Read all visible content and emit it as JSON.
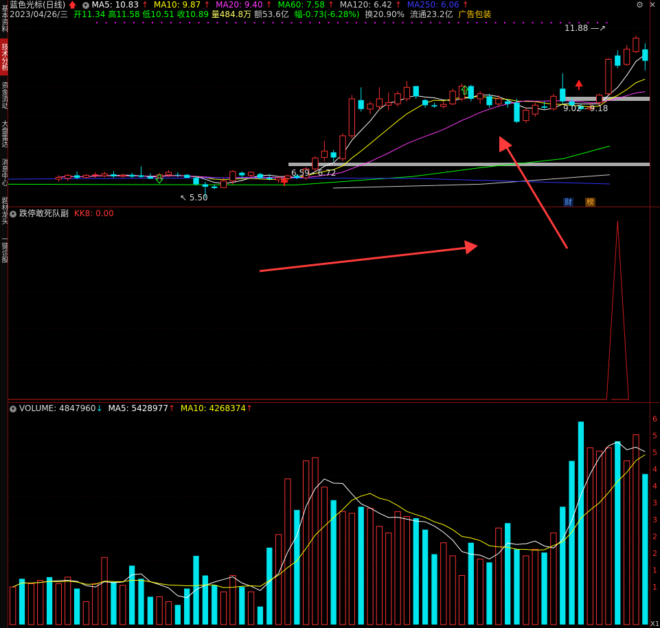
{
  "sidebar": {
    "tabs": [
      {
        "label": "基本资料",
        "active": false
      },
      {
        "label": "技术分析",
        "active": true
      },
      {
        "label": "资金流动",
        "active": false
      },
      {
        "label": "大盘雷达",
        "active": false
      },
      {
        "label": "消息中心",
        "active": false
      },
      {
        "label": "题材龙头",
        "active": false
      },
      {
        "label": "一键诊股",
        "active": false
      }
    ]
  },
  "header": {
    "title": "蓝色光标(日线)",
    "ma5": "MA5: 10.83",
    "ma10": "MA10: 9.87",
    "ma20": "MA20: 9.40",
    "ma60": "MA60: 7.58",
    "ma120": "MA120: 6.42",
    "ma250": "MA250: 6.06",
    "date": "2023/04/26/三",
    "open": "开11.34",
    "high": "高11.58",
    "low": "低10.51",
    "close": "收10.89",
    "vol": "量484.8万",
    "amount": "额53.6亿",
    "change": "幅-0.73(-6.28%)",
    "turnover": "换20.90%",
    "float": "流通23.2亿",
    "ad": "广告包装"
  },
  "price_labels": {
    "high_mark": "11.88",
    "range_upper": "9.02 - 9.18",
    "range_lower": "6.59 - 6.72",
    "low_mark": "5.50",
    "badge_cai": "财",
    "badge_bang": "榜"
  },
  "indicator": {
    "name": "跌停敢死队副",
    "value": "KK8: 0.00"
  },
  "volume_panel": {
    "volume": "VOLUME: 4847960",
    "ma5": "MA5: 5428977",
    "ma10": "MA10: 4268374"
  },
  "volume_axis": [
    "6",
    "5",
    "5",
    "4",
    "4",
    "3",
    "3",
    "2",
    "2",
    "1",
    "1"
  ],
  "volume_axis_unit": "X1",
  "colors": {
    "up": "#ff3232",
    "down": "#00e5ee",
    "ma5": "#ffffff",
    "ma10": "#ffff00",
    "ma20": "#ff3cff",
    "ma60": "#00ff00",
    "ma120": "#cccccc",
    "ma250": "#3333ff",
    "arrow": "#ff3b3b"
  },
  "chart_data": {
    "type": "candlestick",
    "candles": [
      {
        "o": 6.25,
        "h": 6.4,
        "l": 6.15,
        "c": 6.32
      },
      {
        "o": 6.28,
        "h": 6.45,
        "l": 6.18,
        "c": 6.4
      },
      {
        "o": 6.4,
        "h": 6.55,
        "l": 6.25,
        "c": 6.3
      },
      {
        "o": 6.32,
        "h": 6.45,
        "l": 6.28,
        "c": 6.4
      },
      {
        "o": 6.42,
        "h": 6.52,
        "l": 6.3,
        "c": 6.42
      },
      {
        "o": 6.38,
        "h": 6.55,
        "l": 6.32,
        "c": 6.46
      },
      {
        "o": 6.44,
        "h": 6.56,
        "l": 6.3,
        "c": 6.36
      },
      {
        "o": 6.36,
        "h": 6.46,
        "l": 6.3,
        "c": 6.4
      },
      {
        "o": 6.42,
        "h": 6.5,
        "l": 6.3,
        "c": 6.35
      },
      {
        "o": 6.4,
        "h": 6.75,
        "l": 6.3,
        "c": 6.34
      },
      {
        "o": 6.35,
        "h": 6.48,
        "l": 6.25,
        "c": 6.27
      },
      {
        "o": 6.3,
        "h": 6.5,
        "l": 6.28,
        "c": 6.42
      },
      {
        "o": 6.42,
        "h": 6.6,
        "l": 6.34,
        "c": 6.52
      },
      {
        "o": 6.42,
        "h": 6.52,
        "l": 6.33,
        "c": 6.4
      },
      {
        "o": 6.42,
        "h": 6.45,
        "l": 6.3,
        "c": 6.3
      },
      {
        "o": 6.3,
        "h": 6.38,
        "l": 6.0,
        "c": 6.05
      },
      {
        "o": 6.05,
        "h": 6.15,
        "l": 5.5,
        "c": 5.95
      },
      {
        "o": 5.96,
        "h": 6.05,
        "l": 5.85,
        "c": 5.9
      },
      {
        "o": 5.92,
        "h": 6.3,
        "l": 5.9,
        "c": 6.18
      },
      {
        "o": 6.18,
        "h": 6.6,
        "l": 6.05,
        "c": 6.55
      },
      {
        "o": 6.5,
        "h": 6.55,
        "l": 6.3,
        "c": 6.4
      },
      {
        "o": 6.4,
        "h": 6.55,
        "l": 6.3,
        "c": 6.52
      },
      {
        "o": 6.45,
        "h": 6.5,
        "l": 6.25,
        "c": 6.3
      },
      {
        "o": 6.3,
        "h": 6.45,
        "l": 6.2,
        "c": 6.25
      },
      {
        "o": 6.22,
        "h": 6.34,
        "l": 6.1,
        "c": 6.3
      },
      {
        "o": 6.28,
        "h": 6.42,
        "l": 6.18,
        "c": 6.38
      },
      {
        "o": 6.38,
        "h": 6.45,
        "l": 6.25,
        "c": 6.3
      },
      {
        "o": 6.3,
        "h": 6.72,
        "l": 6.22,
        "c": 6.65
      },
      {
        "o": 6.65,
        "h": 7.15,
        "l": 6.55,
        "c": 7.08
      },
      {
        "o": 7.1,
        "h": 7.75,
        "l": 6.95,
        "c": 7.35
      },
      {
        "o": 7.3,
        "h": 7.4,
        "l": 6.95,
        "c": 7.1
      },
      {
        "o": 7.05,
        "h": 8.05,
        "l": 6.95,
        "c": 7.95
      },
      {
        "o": 7.95,
        "h": 9.55,
        "l": 7.85,
        "c": 9.4
      },
      {
        "o": 9.35,
        "h": 9.85,
        "l": 8.9,
        "c": 9.0
      },
      {
        "o": 9.0,
        "h": 9.3,
        "l": 8.8,
        "c": 9.2
      },
      {
        "o": 9.1,
        "h": 9.85,
        "l": 8.95,
        "c": 9.4
      },
      {
        "o": 9.15,
        "h": 9.65,
        "l": 8.95,
        "c": 9.25
      },
      {
        "o": 9.2,
        "h": 9.7,
        "l": 9.1,
        "c": 9.6
      },
      {
        "o": 9.4,
        "h": 10.1,
        "l": 9.3,
        "c": 9.85
      },
      {
        "o": 9.9,
        "h": 9.9,
        "l": 9.4,
        "c": 9.5
      },
      {
        "o": 9.35,
        "h": 9.4,
        "l": 9.05,
        "c": 9.15
      },
      {
        "o": 9.15,
        "h": 9.25,
        "l": 9.05,
        "c": 9.1
      },
      {
        "o": 9.1,
        "h": 9.3,
        "l": 9.02,
        "c": 9.18
      },
      {
        "o": 9.2,
        "h": 9.8,
        "l": 9.15,
        "c": 9.7
      },
      {
        "o": 9.4,
        "h": 10.0,
        "l": 9.3,
        "c": 9.9
      },
      {
        "o": 9.9,
        "h": 9.95,
        "l": 9.3,
        "c": 9.4
      },
      {
        "o": 9.4,
        "h": 9.7,
        "l": 9.2,
        "c": 9.6
      },
      {
        "o": 9.5,
        "h": 9.6,
        "l": 9.05,
        "c": 9.15
      },
      {
        "o": 9.2,
        "h": 9.55,
        "l": 9.1,
        "c": 9.4
      },
      {
        "o": 9.3,
        "h": 9.4,
        "l": 9.05,
        "c": 9.2
      },
      {
        "o": 9.25,
        "h": 9.4,
        "l": 8.45,
        "c": 8.5
      },
      {
        "o": 8.55,
        "h": 9.05,
        "l": 8.45,
        "c": 8.95
      },
      {
        "o": 8.8,
        "h": 9.25,
        "l": 8.7,
        "c": 9.15
      },
      {
        "o": 9.1,
        "h": 9.3,
        "l": 9.0,
        "c": 9.05
      },
      {
        "o": 9.0,
        "h": 9.6,
        "l": 8.95,
        "c": 9.5
      },
      {
        "o": 9.8,
        "h": 10.4,
        "l": 9.2,
        "c": 9.3
      },
      {
        "o": 9.3,
        "h": 9.45,
        "l": 9.1,
        "c": 9.15
      },
      {
        "o": 9.1,
        "h": 9.2,
        "l": 8.95,
        "c": 9.0
      },
      {
        "o": 9.0,
        "h": 9.25,
        "l": 8.95,
        "c": 9.05
      },
      {
        "o": 9.25,
        "h": 9.6,
        "l": 9.15,
        "c": 9.55
      },
      {
        "o": 9.6,
        "h": 11.0,
        "l": 9.55,
        "c": 10.95
      },
      {
        "o": 11.1,
        "h": 11.3,
        "l": 10.6,
        "c": 10.7
      },
      {
        "o": 10.75,
        "h": 11.5,
        "l": 10.7,
        "c": 11.35
      },
      {
        "o": 11.25,
        "h": 11.88,
        "l": 11.2,
        "c": 11.78
      },
      {
        "o": 11.34,
        "h": 11.58,
        "l": 10.51,
        "c": 10.89
      }
    ],
    "volume": [
      1.15,
      1.4,
      1.25,
      1.35,
      1.45,
      1.25,
      1.45,
      1.1,
      0.7,
      1.25,
      2.05,
      1.3,
      1.2,
      1.8,
      1.4,
      0.85,
      0.85,
      0.7,
      0.6,
      1.1,
      2.1,
      1.5,
      1.2,
      1.0,
      1.5,
      1.15,
      1.0,
      0.55,
      2.35,
      2.75,
      4.45,
      3.5,
      5.0,
      5.1,
      4.2,
      3.8,
      3.45,
      3.4,
      3.6,
      3.55,
      3.0,
      2.8,
      3.45,
      3.3,
      3.25,
      2.9,
      2.15,
      2.5,
      2.1,
      1.5,
      2.5,
      2.0,
      1.9,
      2.95,
      3.1,
      2.3,
      2.1,
      2.3,
      2.2,
      2.8,
      3.6,
      5.0,
      6.2,
      5.4,
      5.3,
      5.4,
      5.6,
      5.0,
      5.8,
      4.6
    ],
    "kk8_peak_index": 61,
    "price_range": [
      5.2,
      12.2
    ],
    "volume_range": [
      0,
      6.5
    ]
  }
}
